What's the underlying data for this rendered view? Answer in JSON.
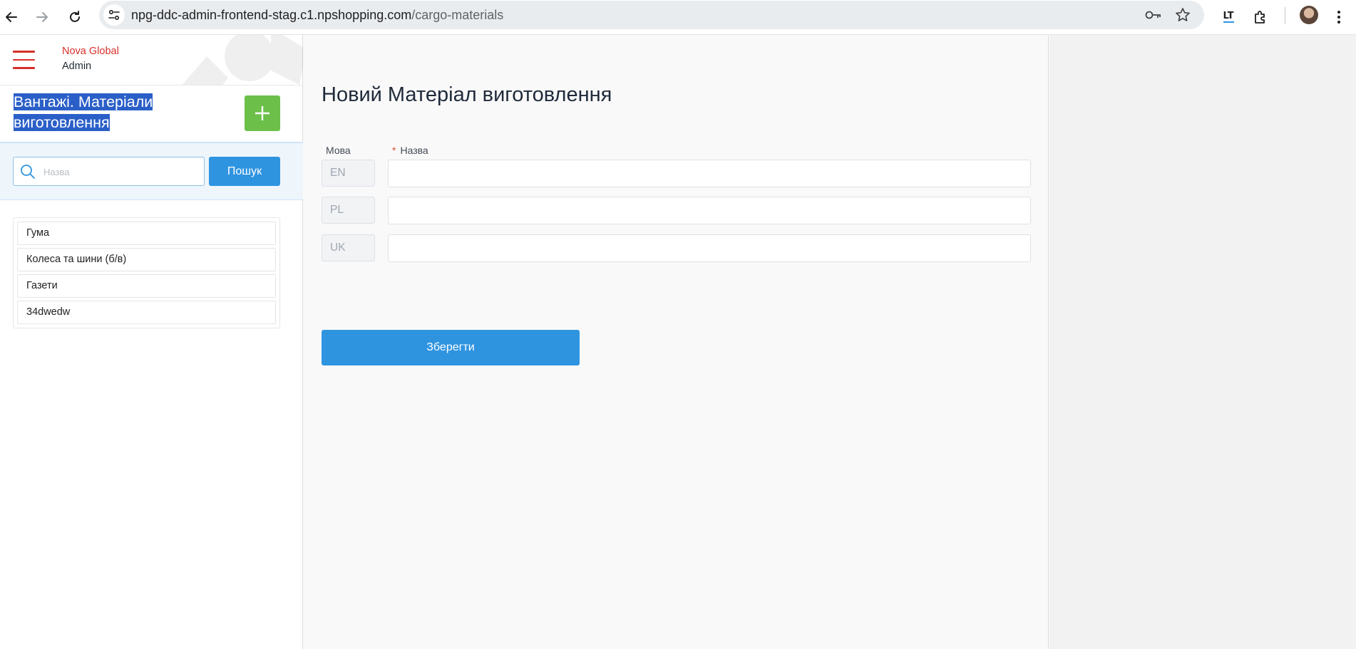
{
  "browser": {
    "url_host": "npg-ddc-admin-frontend-stag.c1.npshopping.com",
    "url_path": "/cargo-materials",
    "icons": [
      "back-icon",
      "forward-icon",
      "reload-icon",
      "site-info-icon",
      "password-key-icon",
      "bookmark-star-icon",
      "language-tool-icon",
      "extensions-icon",
      "profile-avatar",
      "more-menu-icon"
    ],
    "extension_label": "LT"
  },
  "sidebar": {
    "brand_line1": "Nova Global",
    "brand_line2": "Admin",
    "title": "Вантажі. Матеріали виготовлення",
    "add_button_label": "+",
    "search": {
      "placeholder": "Назва",
      "value": "",
      "button_label": "Пошук"
    },
    "items": [
      {
        "label": "Гума"
      },
      {
        "label": "Колеса та шини (б/в)"
      },
      {
        "label": "Газети"
      },
      {
        "label": "34dwedw"
      }
    ]
  },
  "form": {
    "title": "Новий Матеріал виготовлення",
    "language_column_label": "Мова",
    "name_column_label": "Назва",
    "required_marker": "*",
    "rows": [
      {
        "lang": "EN",
        "value": ""
      },
      {
        "lang": "PL",
        "value": ""
      },
      {
        "lang": "UK",
        "value": ""
      }
    ],
    "save_label": "Зберегти"
  },
  "colors": {
    "brand_red": "#d62f2a",
    "primary_blue": "#2f94e0",
    "add_green": "#6cc04a",
    "selection_blue": "#2b5fc8"
  }
}
